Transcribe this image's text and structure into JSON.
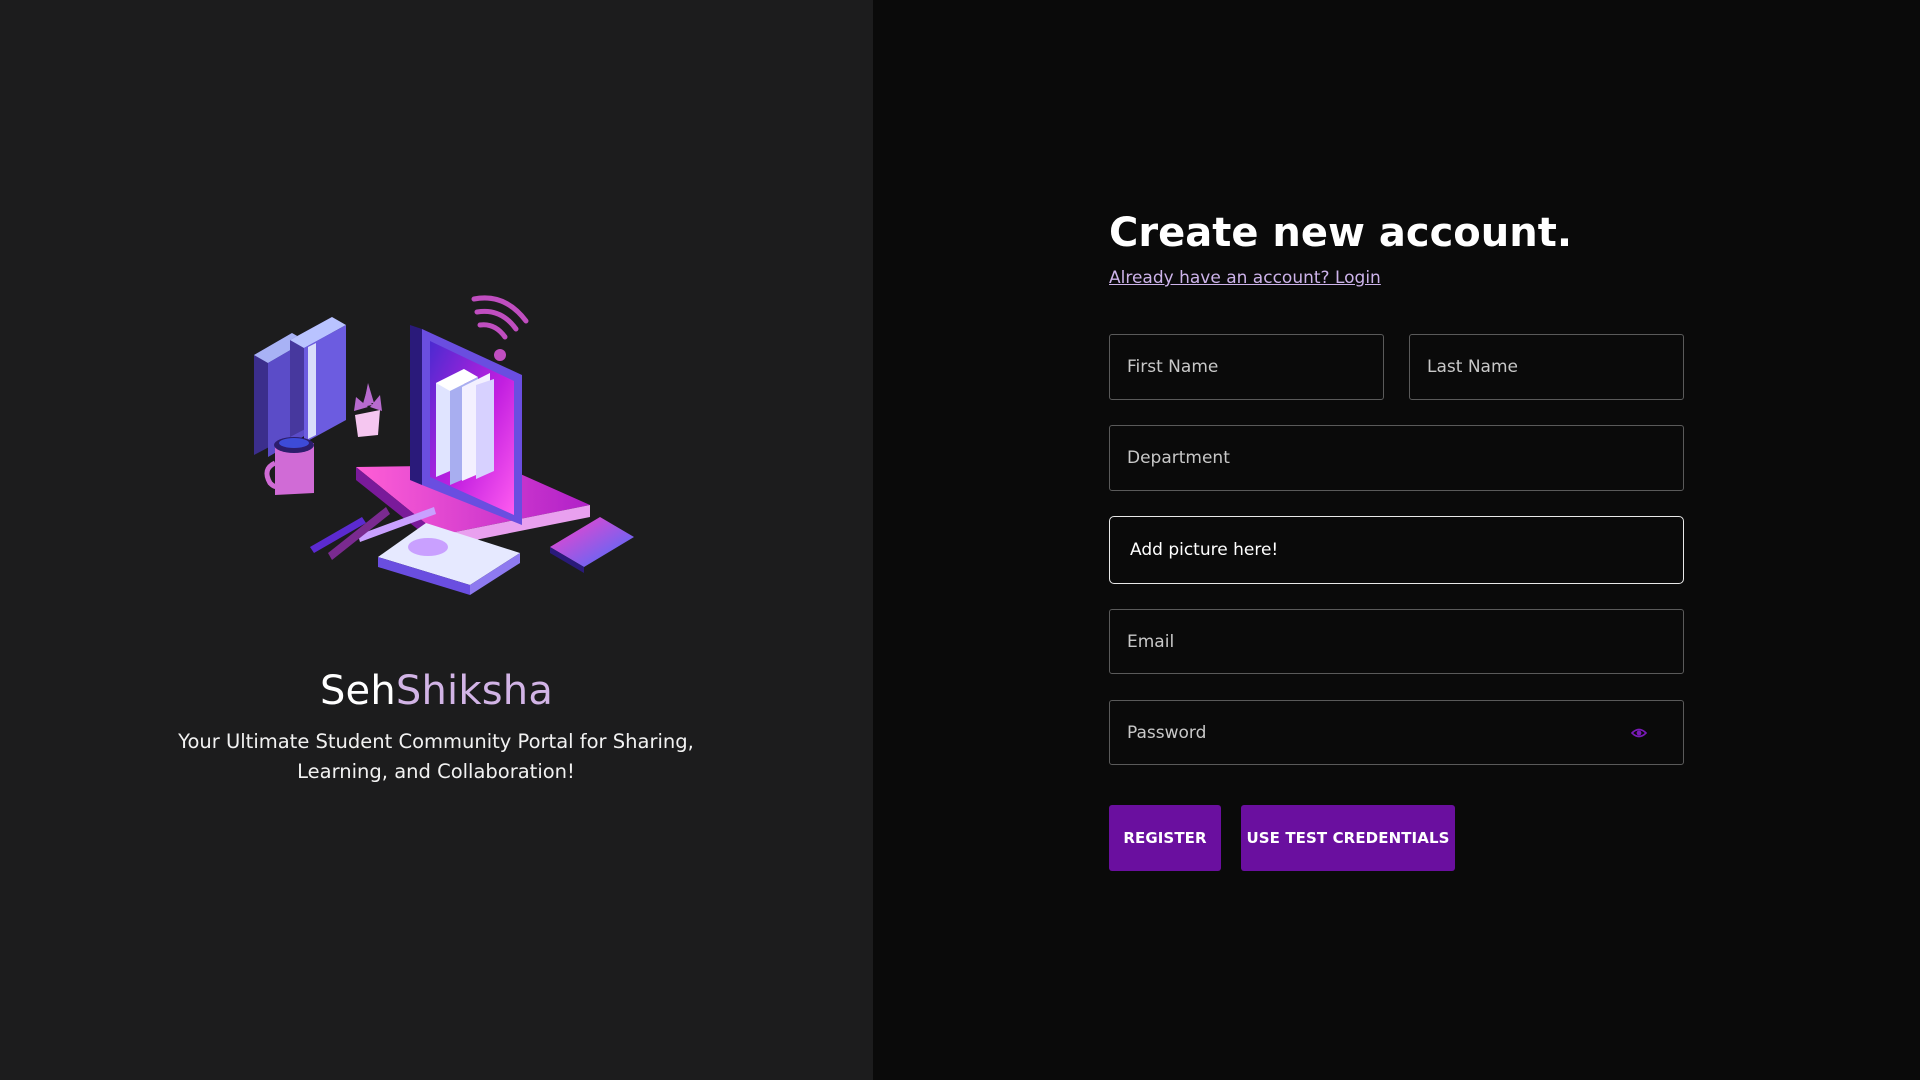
{
  "brand": {
    "part1": "Seh",
    "part2": "Shiksha"
  },
  "tagline": "Your Ultimate Student Community Portal for Sharing, Learning, and Collaboration!",
  "form": {
    "title": "Create new account.",
    "login_link": "Already have an account? Login",
    "first_name": "First Name",
    "last_name": "Last Name",
    "department": "Department",
    "upload": "Add picture here!",
    "email": "Email",
    "password": "Password",
    "register_label": "REGISTER",
    "test_credentials_label": "USE TEST CREDENTIALS"
  },
  "icons": {
    "hero": "study-desk-illustration",
    "password_toggle": "eye-icon"
  },
  "colors": {
    "accent": "#6a0f9f",
    "brand_accent": "#d2b4e6",
    "left_bg": "#1c1c1d",
    "right_bg": "#0a0a0a"
  }
}
